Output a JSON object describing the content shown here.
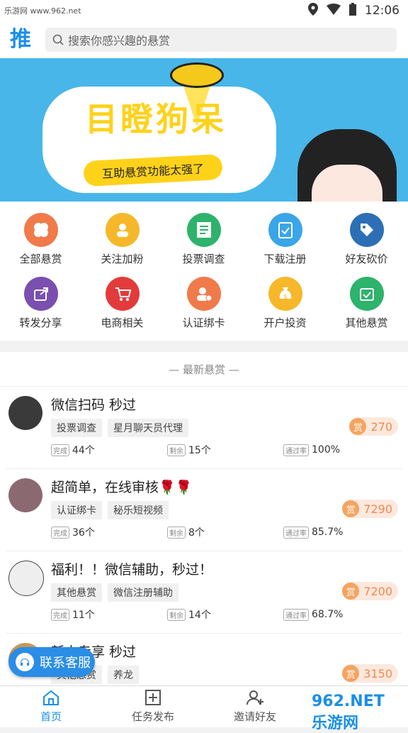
{
  "status": {
    "watermark_left": "乐游网 www.962.net",
    "time": "12:06"
  },
  "header": {
    "logo": "推",
    "search_placeholder": "搜索你感兴趣的悬赏"
  },
  "banner": {
    "title": "目瞪狗呆",
    "subtitle": "互助悬赏功能太强了"
  },
  "categories": [
    {
      "label": "全部悬赏",
      "color": "#f07a4a",
      "icon": "clover-icon"
    },
    {
      "label": "关注加粉",
      "color": "#f6b82a",
      "icon": "users-icon"
    },
    {
      "label": "投票调查",
      "color": "#2db36b",
      "icon": "document-icon"
    },
    {
      "label": "下载注册",
      "color": "#3aa5e8",
      "icon": "clipboard-check-icon"
    },
    {
      "label": "好友砍价",
      "color": "#2c6fb5",
      "icon": "tag-icon"
    },
    {
      "label": "转发分享",
      "color": "#7b4fb0",
      "icon": "share-icon"
    },
    {
      "label": "电商相关",
      "color": "#e33b3b",
      "icon": "cart-icon"
    },
    {
      "label": "认证绑卡",
      "color": "#f07a4a",
      "icon": "user-verify-icon"
    },
    {
      "label": "开户投资",
      "color": "#f6b82a",
      "icon": "money-bag-icon"
    },
    {
      "label": "其他悬赏",
      "color": "#2db36b",
      "icon": "calendar-check-icon"
    }
  ],
  "section_title": "最新悬赏",
  "stat_labels": {
    "done": "完成",
    "remain": "剩余",
    "rate": "通过率"
  },
  "reward_label": "赏",
  "tasks": [
    {
      "title": "微信扫码 秒过",
      "tags": [
        "投票调查",
        "星月聊天员代理"
      ],
      "done": "44个",
      "remain": "15个",
      "rate": "100%",
      "reward": "270"
    },
    {
      "title": "超简单，在线审核🌹🌹",
      "tags": [
        "认证绑卡",
        "秘乐短视频"
      ],
      "done": "36个",
      "remain": "8个",
      "rate": "85.7%",
      "reward": "7290"
    },
    {
      "title": "福利！！微信辅助，秒过！",
      "tags": [
        "其他悬赏",
        "微信注册辅助"
      ],
      "done": "11个",
      "remain": "14个",
      "rate": "68.7%",
      "reward": "7200"
    },
    {
      "title": "新人专享 秒过",
      "tags": [
        "其他悬赏",
        "养龙"
      ],
      "reward": "3150"
    }
  ],
  "service_button": "联系客服",
  "nav": [
    {
      "label": "首页"
    },
    {
      "label": "任务发布"
    },
    {
      "label": "邀请好友"
    }
  ],
  "corner_watermark": "962.NET 乐游网",
  "colors": {
    "primary": "#1a8fe8",
    "reward": "#f08a4b"
  }
}
